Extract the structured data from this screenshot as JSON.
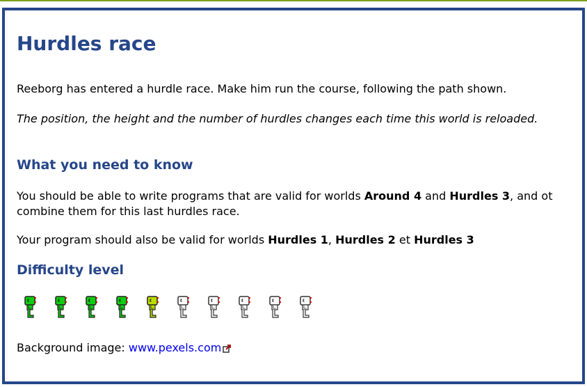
{
  "title": "Hurdles race",
  "intro": "Reeborg has entered a hurdle race. Make him run the course, following the path shown.",
  "note": "The position, the height and the number of hurdles changes each time this world is reloaded.",
  "section_know": {
    "heading": "What you need to know",
    "p1": {
      "a": "You should be able to write programs that are valid for worlds ",
      "b1": "Around 4",
      "c": " and ",
      "b2": "Hurdles 3",
      "d": ", and ot combine them for this last hurdles race."
    },
    "p2": {
      "a": "Your program should also be valid for worlds ",
      "b1": "Hurdles 1",
      "c": ", ",
      "b2": "Hurdles 2",
      "d": " et ",
      "b3": "Hurdles 3"
    }
  },
  "difficulty": {
    "heading": "Difficulty level",
    "level": 5,
    "max": 10,
    "colors": {
      "filled": "#11cc11",
      "current": "#bbdd00",
      "empty": "#ffffff"
    }
  },
  "credit": {
    "label": "Background image: ",
    "link": "www.pexels.com",
    "icon": "external-link-icon"
  },
  "colors": {
    "accent": "#26468a",
    "topline": "#7ba01c"
  }
}
